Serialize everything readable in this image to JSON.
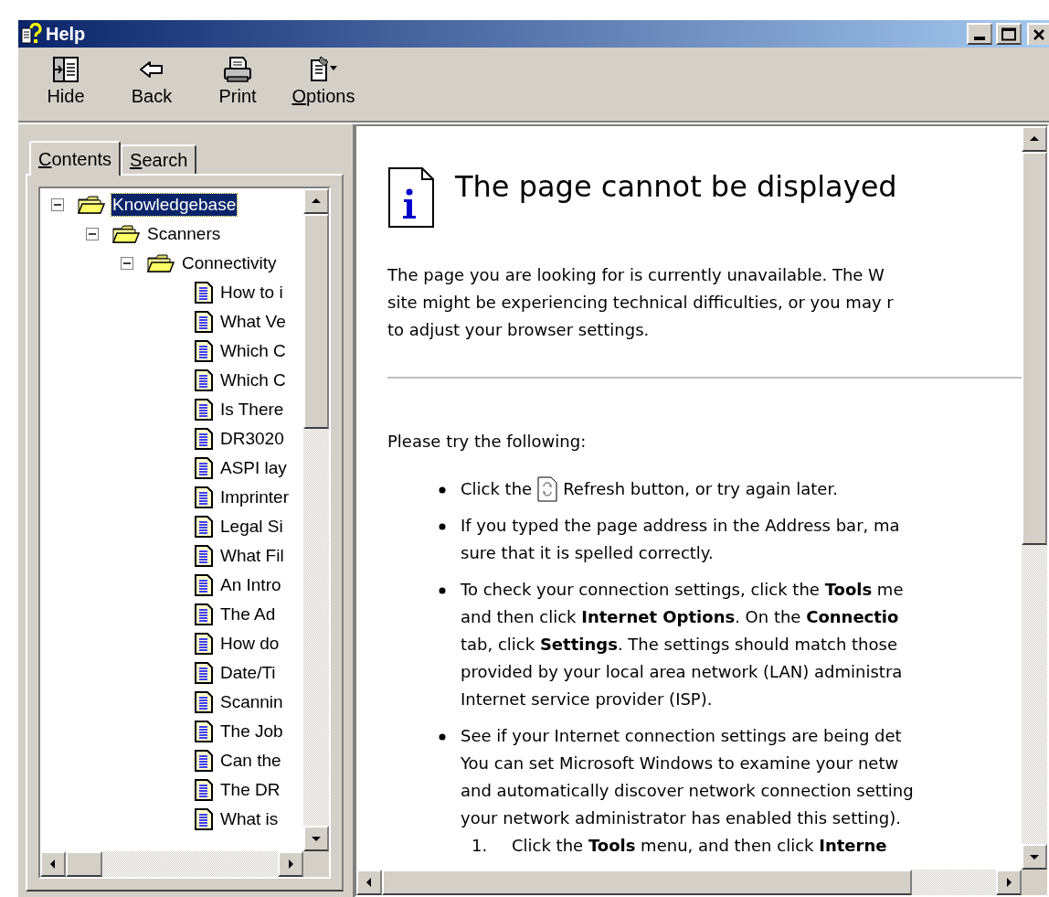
{
  "window": {
    "title": "Help"
  },
  "toolbar": [
    {
      "label": "Hide",
      "kind": "hide",
      "mnemonic": false
    },
    {
      "label": "Back",
      "kind": "back",
      "mnemonic": false
    },
    {
      "label": "Print",
      "kind": "print",
      "mnemonic": false
    },
    {
      "label": "Options",
      "kind": "options",
      "mnemonic": true
    }
  ],
  "tabs": [
    {
      "label": "Contents",
      "selected": true,
      "mnemonic": true
    },
    {
      "label": "Search",
      "selected": false,
      "mnemonic": true
    }
  ],
  "tree": [
    {
      "label": "Knowledgebase",
      "kind": "folder",
      "expanded": true,
      "selected": true,
      "children": [
        {
          "label": "Scanners",
          "kind": "folder",
          "expanded": true,
          "selected": false,
          "children": [
            {
              "label": "Connectivity",
              "kind": "folder",
              "expanded": true,
              "selected": false,
              "children": [
                {
                  "label": "How to i",
                  "kind": "document",
                  "selected": false
                },
                {
                  "label": "What Ve",
                  "kind": "document",
                  "selected": false
                },
                {
                  "label": "Which C",
                  "kind": "document",
                  "selected": false
                },
                {
                  "label": "Which C",
                  "kind": "document",
                  "selected": false
                },
                {
                  "label": "Is There",
                  "kind": "document",
                  "selected": false
                },
                {
                  "label": "DR3020",
                  "kind": "document",
                  "selected": false
                },
                {
                  "label": "ASPI lay",
                  "kind": "document",
                  "selected": false
                },
                {
                  "label": "Imprinter",
                  "kind": "document",
                  "selected": false
                },
                {
                  "label": "Legal Si",
                  "kind": "document",
                  "selected": false
                },
                {
                  "label": "What Fil",
                  "kind": "document",
                  "selected": false
                },
                {
                  "label": "An Intro",
                  "kind": "document",
                  "selected": false
                },
                {
                  "label": "The Ad",
                  "kind": "document",
                  "selected": false
                },
                {
                  "label": "How do",
                  "kind": "document",
                  "selected": false
                },
                {
                  "label": "Date/Ti",
                  "kind": "document",
                  "selected": false
                },
                {
                  "label": "Scannin",
                  "kind": "document",
                  "selected": false
                },
                {
                  "label": "The Job",
                  "kind": "document",
                  "selected": false
                },
                {
                  "label": "Can the",
                  "kind": "document",
                  "selected": false
                },
                {
                  "label": "The DR",
                  "kind": "document",
                  "selected": false
                },
                {
                  "label": "What is",
                  "kind": "document",
                  "selected": false
                }
              ]
            }
          ]
        }
      ]
    }
  ],
  "content": {
    "title": "The page cannot be displayed",
    "intro_lines": [
      "The page you are looking for is currently unavailable. The W",
      "site might be experiencing technical difficulties, or you may r",
      "to adjust your browser settings."
    ],
    "prompt": "Please try the following:",
    "bullets": [
      {
        "kind": "refresh",
        "before": "Click the",
        "after": "Refresh button, or try again later."
      },
      {
        "kind": "text",
        "lines": [
          "If you typed the page address in the Address bar, ma",
          "sure that it is spelled correctly."
        ]
      },
      {
        "kind": "text",
        "lines": [
          "To check your connection settings, click the **Tools** me",
          "and then click **Internet Options**. On the **Connectio**",
          "tab, click **Settings**. The settings should match those",
          "provided by your local area network (LAN) administra",
          "Internet service provider (ISP)."
        ]
      },
      {
        "kind": "text",
        "lines": [
          "See if your Internet connection settings are being det",
          "You can set Microsoft Windows to examine your netw",
          "and automatically discover network connection setting",
          "your network administrator has enabled this setting)."
        ]
      }
    ],
    "steps": [
      {
        "number": "1.",
        "lines": [
          "Click the **Tools** menu, and then click **Interne**"
        ]
      }
    ]
  }
}
